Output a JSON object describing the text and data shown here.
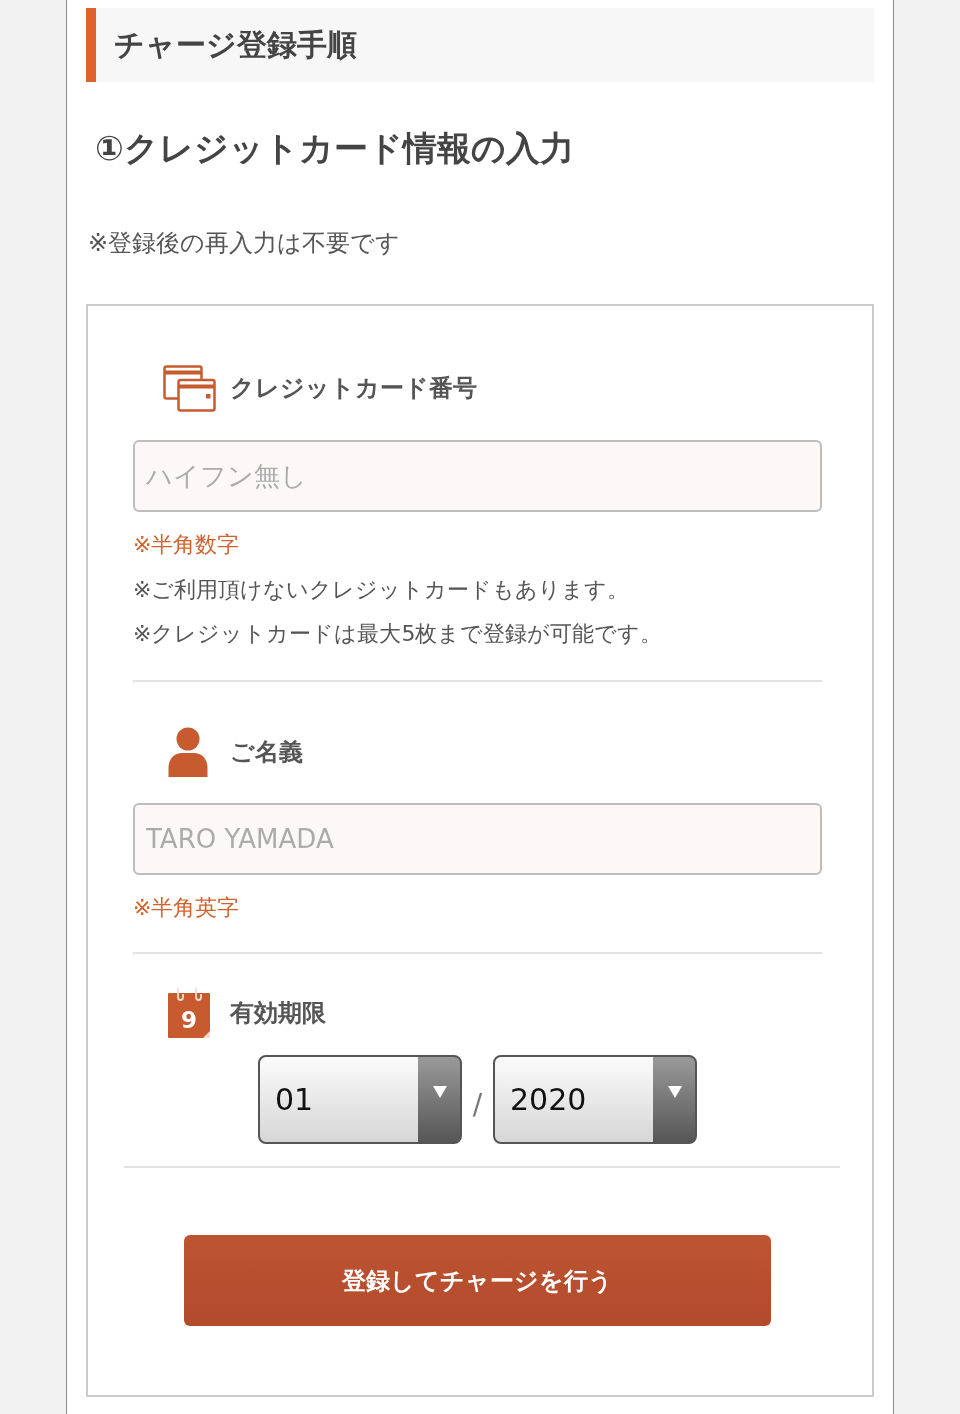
{
  "header": {
    "title": "チャージ登録手順"
  },
  "step": {
    "title": "①クレジットカード情報の入力",
    "note": "※登録後の再入力は不要です"
  },
  "card_number": {
    "label": "クレジットカード番号",
    "input": {
      "placeholder": "ハイフン無し"
    },
    "notes": [
      {
        "text": "※半角数字",
        "color": "#d0622e"
      },
      {
        "text": "※ご利用頂けないクレジットカードもあります。",
        "color": "#555555"
      },
      {
        "text": "※クレジットカードは最大5枚まで登録が可能です。",
        "color": "#555555"
      }
    ]
  },
  "card_holder": {
    "label": "ご名義",
    "input": {
      "placeholder": "TARO YAMADA"
    },
    "notes": [
      {
        "text": "※半角英字",
        "color": "#d0622e"
      }
    ]
  },
  "expiry": {
    "label": "有効期限",
    "icon_text": "9",
    "month": {
      "value": "01"
    },
    "separator": "/",
    "year": {
      "value": "2020"
    }
  },
  "submit_button": {
    "label": "登録してチャージを行う"
  }
}
